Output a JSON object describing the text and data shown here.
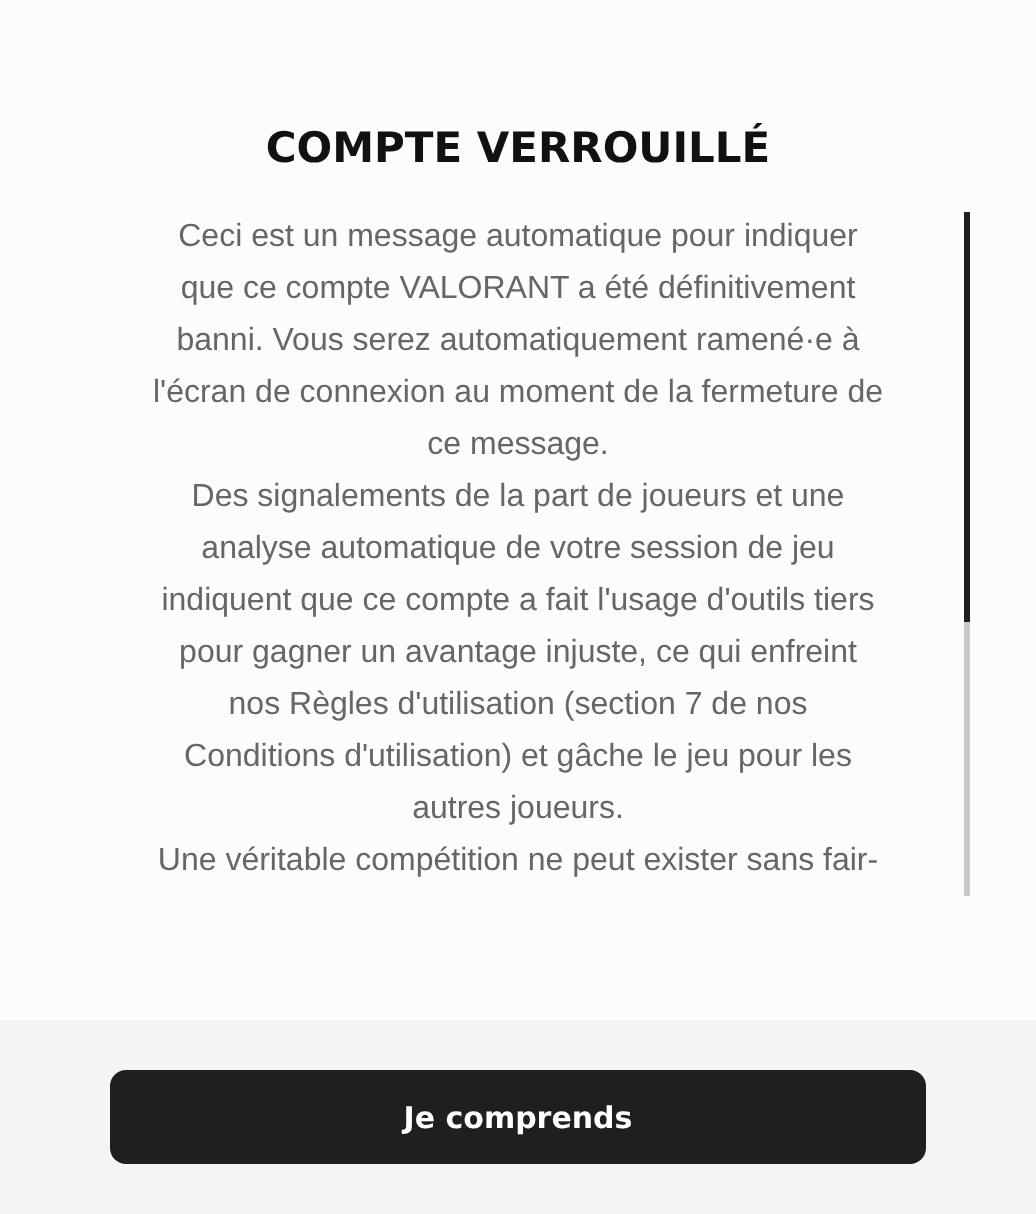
{
  "dialog": {
    "title": "COMPTE VERROUILLÉ",
    "message_paragraphs": [
      {
        "lines": [
          "Ceci est un message automatique pour indiquer",
          "que ce compte VALORANT a été définitivement",
          "banni. Vous serez automatiquement ramené·e à",
          "l'écran de connexion au moment de la fermeture de",
          "ce message."
        ]
      },
      {
        "lines": [
          "Des signalements de la part de joueurs et une",
          "analyse automatique de votre session de jeu",
          "indiquent que ce compte a fait l'usage d'outils tiers",
          "pour gagner un avantage injuste, ce qui enfreint",
          "nos Règles d'utilisation (section 7 de nos",
          "Conditions d'utilisation) et gâche le jeu pour les",
          "autres joueurs."
        ]
      },
      {
        "lines": [
          "Une véritable compétition ne peut exister sans fair-"
        ]
      }
    ],
    "button": "Je comprends"
  }
}
